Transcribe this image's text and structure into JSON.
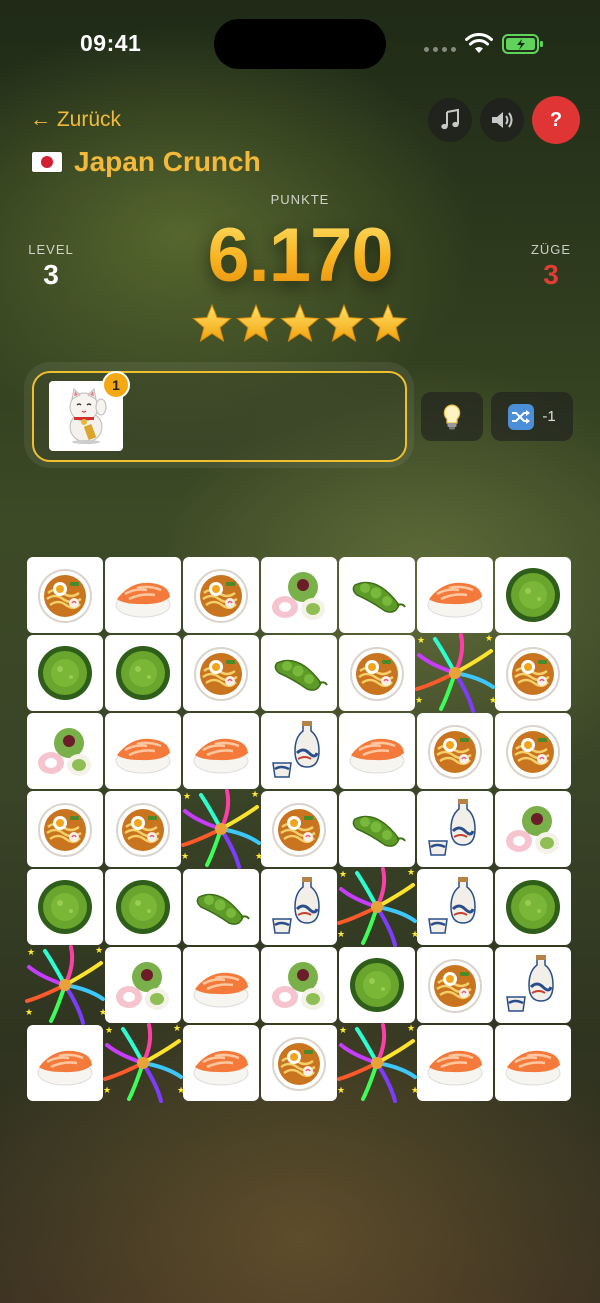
{
  "status_bar": {
    "time": "09:41"
  },
  "header": {
    "back_label": "← Zurück",
    "title": "Japan Crunch",
    "flag_icon": "japan-flag-icon",
    "music_icon": "music-note-icon",
    "sound_icon": "speaker-icon",
    "help_label": "?"
  },
  "score": {
    "label": "PUNKTE",
    "value": "6.170",
    "stars": 5,
    "stars_max": 5
  },
  "stats": {
    "level_label": "LEVEL",
    "level_value": "3",
    "moves_label": "ZÜGE",
    "moves_value": "3"
  },
  "tray": {
    "items": [
      {
        "icon": "lucky-cat-icon",
        "count": "1"
      }
    ]
  },
  "tools": {
    "hint_icon": "lightbulb-icon",
    "shuffle_icon": "shuffle-icon",
    "shuffle_cost": "-1"
  },
  "colors": {
    "accent": "#f3b93a",
    "help": "#e03535",
    "moves": "#e03d35",
    "tray_border": "#f0bf2e"
  },
  "board": {
    "columns": 7,
    "rows": [
      [
        "ramen",
        "sushi",
        "ramen",
        "mochi",
        "edamame",
        "sushi",
        "matcha"
      ],
      [
        "matcha",
        "matcha",
        "ramen",
        "edamame",
        "ramen",
        "burst",
        "ramen"
      ],
      [
        "mochi",
        "sushi",
        "sushi",
        "sake",
        "sushi",
        "ramen",
        "ramen"
      ],
      [
        "ramen",
        "ramen",
        "burst",
        "ramen",
        "edamame",
        "sake",
        "mochi"
      ],
      [
        "matcha",
        "matcha",
        "edamame",
        "sake",
        "burst",
        "sake",
        "matcha"
      ],
      [
        "burst",
        "mochi",
        "sushi",
        "mochi",
        "matcha",
        "ramen",
        "sake"
      ],
      [
        "sushi",
        "burst",
        "sushi",
        "ramen",
        "burst",
        "sushi",
        "sushi"
      ]
    ]
  }
}
